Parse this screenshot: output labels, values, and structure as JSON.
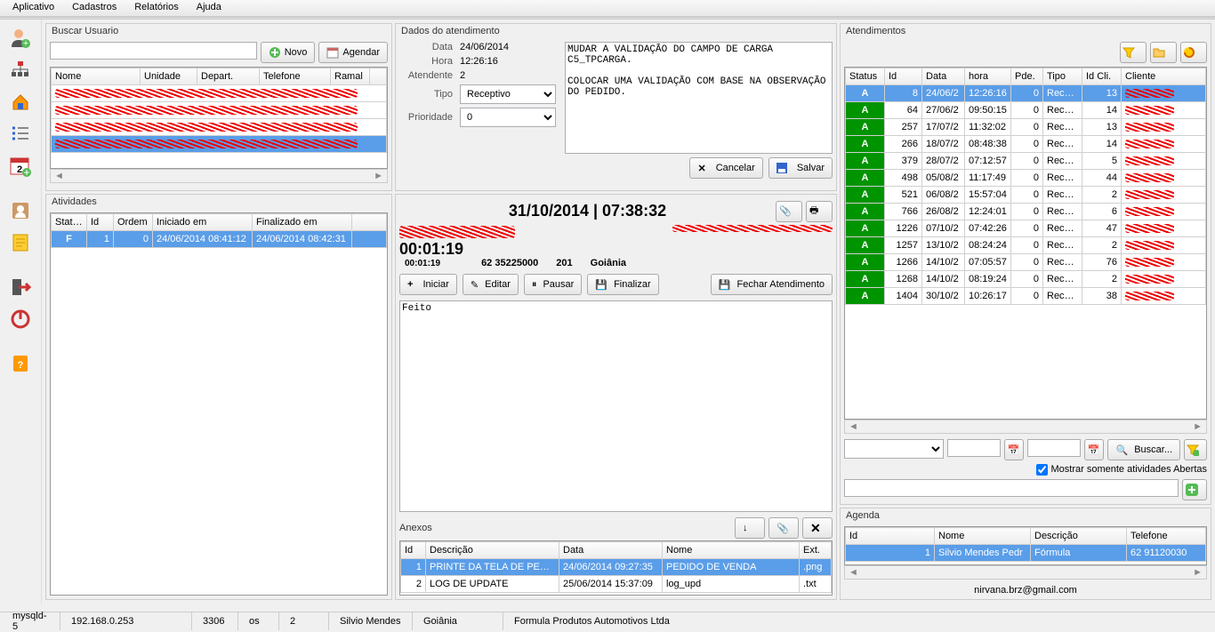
{
  "menu": {
    "aplicativo": "Aplicativo",
    "cadastros": "Cadastros",
    "relatorios": "Relatórios",
    "ajuda": "Ajuda"
  },
  "buscar": {
    "title": "Buscar Usuario",
    "novo": "Novo",
    "agendar": "Agendar",
    "cols": {
      "nome": "Nome",
      "unidade": "Unidade",
      "depart": "Depart.",
      "telefone": "Telefone",
      "ramal": "Ramal"
    }
  },
  "atividades": {
    "title": "Atividades",
    "cols": {
      "status": "Status",
      "id": "Id",
      "ordem": "Ordem",
      "iniciado": "Iniciado em",
      "finalizado": "Finalizado em"
    },
    "row": {
      "status": "F",
      "id": "1",
      "ordem": "0",
      "iniciado": "24/06/2014 08:41:12",
      "finalizado": "24/06/2014 08:42:31"
    }
  },
  "dados": {
    "title": "Dados do atendimento",
    "labels": {
      "data": "Data",
      "hora": "Hora",
      "atendente": "Atendente",
      "tipo": "Tipo",
      "prioridade": "Prioridade"
    },
    "values": {
      "data": "24/06/2014",
      "hora": "12:26:16",
      "atendente": "2",
      "tipo": "Receptivo",
      "prioridade": "0"
    },
    "obs": "MUDAR A VALIDAÇÃO DO CAMPO DE CARGA C5_TPCARGA.\n\nCOLOCAR UMA VALIDAÇÃO COM BASE NA OBSERVAÇÃO DO PEDIDO.",
    "cancelar": "Cancelar",
    "salvar": "Salvar"
  },
  "header": {
    "datetime": "31/10/2014 | 07:38:32",
    "timer": "00:01:19",
    "timer_small": "00:01:19",
    "phone": "62 35225000",
    "ramal": "201",
    "city": "Goiânia"
  },
  "actions": {
    "iniciar": "Iniciar",
    "editar": "Editar",
    "pausar": "Pausar",
    "finalizar": "Finalizar",
    "fechar": "Fechar Atendimento"
  },
  "note": "Feito",
  "anexos": {
    "title": "Anexos",
    "cols": {
      "id": "Id",
      "descricao": "Descrição",
      "data": "Data",
      "nome": "Nome",
      "ext": "Ext."
    },
    "rows": [
      {
        "id": "1",
        "descricao": "PRINTE DA TELA DE PEDIDO",
        "data": "24/06/2014 09:27:35",
        "nome": "PEDIDO DE VENDA",
        "ext": ".png",
        "sel": true
      },
      {
        "id": "2",
        "descricao": "LOG DE UPDATE",
        "data": "25/06/2014 15:37:09",
        "nome": "log_upd",
        "ext": ".txt",
        "sel": false
      }
    ]
  },
  "atend": {
    "title": "Atendimentos",
    "cols": {
      "status": "Status",
      "id": "Id",
      "data": "Data",
      "hora": "hora",
      "pde": "Pde.",
      "tipo": "Tipo",
      "idcli": "Id Cli.",
      "cliente": "Cliente"
    },
    "rows": [
      {
        "s": "A",
        "id": "8",
        "data": "24/06/2",
        "hora": "12:26:16",
        "pde": "0",
        "tipo": "Receptiv",
        "idcli": "13",
        "sel": true
      },
      {
        "s": "A",
        "id": "64",
        "data": "27/06/2",
        "hora": "09:50:15",
        "pde": "0",
        "tipo": "Receptiv",
        "idcli": "14"
      },
      {
        "s": "A",
        "id": "257",
        "data": "17/07/2",
        "hora": "11:32:02",
        "pde": "0",
        "tipo": "Receptiv",
        "idcli": "13"
      },
      {
        "s": "A",
        "id": "266",
        "data": "18/07/2",
        "hora": "08:48:38",
        "pde": "0",
        "tipo": "Receptiv",
        "idcli": "14"
      },
      {
        "s": "A",
        "id": "379",
        "data": "28/07/2",
        "hora": "07:12:57",
        "pde": "0",
        "tipo": "Receptiv",
        "idcli": "5"
      },
      {
        "s": "A",
        "id": "498",
        "data": "05/08/2",
        "hora": "11:17:49",
        "pde": "0",
        "tipo": "Receptiv",
        "idcli": "44"
      },
      {
        "s": "A",
        "id": "521",
        "data": "06/08/2",
        "hora": "15:57:04",
        "pde": "0",
        "tipo": "Receptiv",
        "idcli": "2"
      },
      {
        "s": "A",
        "id": "766",
        "data": "26/08/2",
        "hora": "12:24:01",
        "pde": "0",
        "tipo": "Receptiv",
        "idcli": "6"
      },
      {
        "s": "A",
        "id": "1226",
        "data": "07/10/2",
        "hora": "07:42:26",
        "pde": "0",
        "tipo": "Receptiv",
        "idcli": "47"
      },
      {
        "s": "A",
        "id": "1257",
        "data": "13/10/2",
        "hora": "08:24:24",
        "pde": "0",
        "tipo": "Receptiv",
        "idcli": "2"
      },
      {
        "s": "A",
        "id": "1266",
        "data": "14/10/2",
        "hora": "07:05:57",
        "pde": "0",
        "tipo": "Receptiv",
        "idcli": "76"
      },
      {
        "s": "A",
        "id": "1268",
        "data": "14/10/2",
        "hora": "08:19:24",
        "pde": "0",
        "tipo": "Receptiv",
        "idcli": "2"
      },
      {
        "s": "A",
        "id": "1404",
        "data": "30/10/2",
        "hora": "10:26:17",
        "pde": "0",
        "tipo": "Receptiv",
        "idcli": "38"
      }
    ],
    "buscar": "Buscar...",
    "mostrar": "Mostrar somente atividades Abertas"
  },
  "agenda": {
    "title": "Agenda",
    "cols": {
      "id": "Id",
      "nome": "Nome",
      "descricao": "Descrição",
      "telefone": "Telefone"
    },
    "row": {
      "id": "1",
      "nome": "Silvio Mendes Pedr",
      "descricao": "Fórmula",
      "telefone": "62 91120030"
    },
    "email": "nirvana.brz@gmail.com"
  },
  "status": {
    "db": "mysqld-5",
    "ip": "192.168.0.253",
    "port": "3306",
    "os": "os",
    "n": "2",
    "user": "Silvio Mendes",
    "city": "Goiânia",
    "org": "Formula Produtos Automotivos Ltda"
  }
}
